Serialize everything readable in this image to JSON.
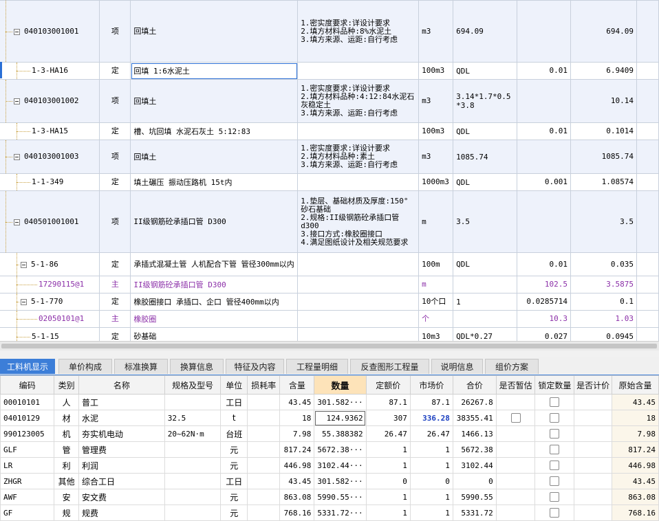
{
  "top_rows": [
    {
      "type": "item",
      "code": "040103001001",
      "cat": "项",
      "name": "回填土",
      "desc": [
        "1.密实度要求:详设计要求",
        "2.填方材料品种:8%水泥土",
        "3.填方来源、运距:自行考虑"
      ],
      "unit": "m3",
      "expr": "694.09",
      "coef": "",
      "qty": "694.09"
    },
    {
      "type": "sub",
      "code": "1-3-HA16",
      "cat": "定",
      "name": "回填 1:6水泥土",
      "desc": [],
      "unit": "100m3",
      "expr": "QDL",
      "coef": "0.01",
      "qty": "6.9409"
    },
    {
      "type": "item",
      "code": "040103001002",
      "cat": "项",
      "name": "回填土",
      "desc": [
        "1.密实度要求:详设计要求",
        "2.填方材料品种:4:12:84水泥石灰稳定土",
        "3.填方来源、运距:自行考虑"
      ],
      "unit": "m3",
      "expr": "3.14*1.7*0.5*3.8",
      "coef": "",
      "qty": "10.14"
    },
    {
      "type": "sub",
      "code": "1-3-HA15",
      "cat": "定",
      "name": "槽、坑回填 水泥石灰土 5:12:83",
      "desc": [],
      "unit": "100m3",
      "expr": "QDL",
      "coef": "0.01",
      "qty": "0.1014"
    },
    {
      "type": "item",
      "code": "040103001003",
      "cat": "项",
      "name": "回填土",
      "desc": [
        "1.密实度要求:详设计要求",
        "2.填方材料品种:素土",
        "3.填方来源、运距:自行考虑"
      ],
      "unit": "m3",
      "expr": "1085.74",
      "coef": "",
      "qty": "1085.74"
    },
    {
      "type": "sub",
      "code": "1-1-349",
      "cat": "定",
      "name": "填土碾压 振动压路机 15t内",
      "desc": [],
      "unit": "1000m3",
      "expr": "QDL",
      "coef": "0.001",
      "qty": "1.08574"
    },
    {
      "type": "item",
      "code": "040501001001",
      "cat": "项",
      "name": "II级钢筋砼承插口管 D300",
      "desc": [
        "1.垫层、基础材质及厚度:150°砂石基础",
        "2.规格:II级钢筋砼承插口管d300",
        "3.接口方式:橡胶圈接口",
        "4.满足图纸设计及相关规范要求"
      ],
      "unit": "m",
      "expr": "3.5",
      "coef": "",
      "qty": "3.5"
    },
    {
      "type": "sub",
      "code": "5-1-86",
      "cat": "定",
      "name": "承插式混凝土管 人机配合下管 管径300mm以内",
      "desc": [],
      "unit": "100m",
      "expr": "QDL",
      "coef": "0.01",
      "qty": "0.035"
    },
    {
      "type": "mat",
      "code": "17290115@1",
      "cat": "主",
      "name": "II级钢筋砼承插口管 D300",
      "desc": [],
      "unit": "m",
      "expr": "",
      "coef": "102.5",
      "qty": "3.5875"
    },
    {
      "type": "sub",
      "code": "5-1-770",
      "cat": "定",
      "name": "橡胶圈接口 承插口、企口 管径400mm以内",
      "desc": [],
      "unit": "10个口",
      "expr": "1",
      "coef": "0.0285714",
      "qty": "0.1"
    },
    {
      "type": "mat",
      "code": "02050101@1",
      "cat": "主",
      "name": "橡胶圈",
      "desc": [],
      "unit": "个",
      "expr": "",
      "coef": "10.3",
      "qty": "1.03"
    },
    {
      "type": "sub",
      "code": "5-1-15",
      "cat": "定",
      "name": "砂基础",
      "desc": [],
      "unit": "10m3",
      "expr": "QDL*0.27",
      "coef": "0.027",
      "qty": "0.0945"
    }
  ],
  "tabs": [
    "工料机显示",
    "单价构成",
    "标准换算",
    "换算信息",
    "特征及内容",
    "工程量明细",
    "反查图形工程量",
    "说明信息",
    "组价方案"
  ],
  "bottom": {
    "headers": [
      "编码",
      "类别",
      "名称",
      "规格及型号",
      "单位",
      "损耗率",
      "含量",
      "数量",
      "定额价",
      "市场价",
      "合价",
      "是否暂估",
      "锁定数量",
      "是否计价",
      "原始含量"
    ],
    "rows": [
      {
        "code": "00010101",
        "cat": "人",
        "name": "普工",
        "spec": "",
        "unit": "工日",
        "loss": "",
        "content": "43.45",
        "qty": "301.582···",
        "quota": "87.1",
        "market": "87.1",
        "total": "26267.8",
        "est": false,
        "lock": true,
        "orig": "43.45"
      },
      {
        "code": "04010129",
        "cat": "材",
        "name": "水泥",
        "spec": "32.5",
        "unit": "t",
        "loss": "",
        "content": "18",
        "qty": "124.9362",
        "quota": "307",
        "market": "336.28",
        "total": "38355.41",
        "est": true,
        "lock": true,
        "orig": "18"
      },
      {
        "code": "990123005",
        "cat": "机",
        "name": "夯实机电动",
        "spec": "20~62N·m",
        "unit": "台班",
        "loss": "",
        "content": "7.98",
        "qty": "55.388382",
        "quota": "26.47",
        "market": "26.47",
        "total": "1466.13",
        "est": false,
        "lock": true,
        "orig": "7.98"
      },
      {
        "code": "GLF",
        "cat": "管",
        "name": "管理费",
        "spec": "",
        "unit": "元",
        "loss": "",
        "content": "817.24",
        "qty": "5672.38···",
        "quota": "1",
        "market": "1",
        "total": "5672.38",
        "est": false,
        "lock": true,
        "orig": "817.24"
      },
      {
        "code": "LR",
        "cat": "利",
        "name": "利润",
        "spec": "",
        "unit": "元",
        "loss": "",
        "content": "446.98",
        "qty": "3102.44···",
        "quota": "1",
        "market": "1",
        "total": "3102.44",
        "est": false,
        "lock": true,
        "orig": "446.98"
      },
      {
        "code": "ZHGR",
        "cat": "其他",
        "name": "综合工日",
        "spec": "",
        "unit": "工日",
        "loss": "",
        "content": "43.45",
        "qty": "301.582···",
        "quota": "0",
        "market": "0",
        "total": "0",
        "est": false,
        "lock": true,
        "orig": "43.45"
      },
      {
        "code": "AWF",
        "cat": "安",
        "name": "安文费",
        "spec": "",
        "unit": "元",
        "loss": "",
        "content": "863.08",
        "qty": "5990.55···",
        "quota": "1",
        "market": "1",
        "total": "5990.55",
        "est": false,
        "lock": true,
        "orig": "863.08"
      },
      {
        "code": "GF",
        "cat": "规",
        "name": "规费",
        "spec": "",
        "unit": "元",
        "loss": "",
        "content": "768.16",
        "qty": "5331.72···",
        "quota": "1",
        "market": "1",
        "total": "5331.72",
        "est": false,
        "lock": true,
        "orig": "768.16"
      }
    ]
  },
  "colors": {
    "accent": "#3c7ed8",
    "material_text": "#8b2fa8",
    "highlight_price": "#1a3fc0",
    "sorted_header": "#fde3b9"
  }
}
